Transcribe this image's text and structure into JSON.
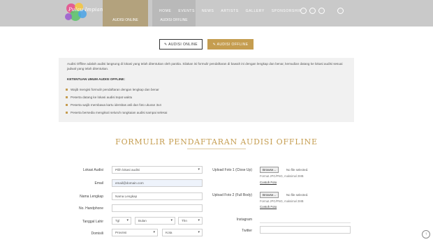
{
  "header": {
    "logo_text": "Pulau Impian",
    "tab_a": "AUDISI ONLINE",
    "tab_b": "AUDISI OFFLINE",
    "nav": [
      "HOME",
      "EVENTS",
      "NEWS",
      "ARTISTS",
      "GALLERY",
      "SPONSORSHIP"
    ],
    "social_icons": [
      "instagram-icon",
      "facebook-icon",
      "twitter-icon",
      "youtube-icon"
    ]
  },
  "buttons": {
    "online": "✎ AUDISI ONLINE",
    "offline": "✎ AUDISI OFFLINE"
  },
  "info": {
    "intro": "Audisi Offline adalah audisi langsung di lokasi yang telah ditentukan oleh panitia. Silakan isi formulir pendaftaran di bawah ini dengan lengkap dan benar, kemudian datang ke lokasi audisi sesuai jadwal yang telah ditentukan.",
    "heading": "KETENTUAN UMUM AUDISI OFFLINE:",
    "rules": [
      "Wajib mengisi formulir pendaftaran dengan lengkap dan benar",
      "Peserta datang ke lokasi audisi tepat waktu",
      "Peserta wajib membawa kartu identitas asli dan foto ukuran 3x4",
      "Peserta bersedia mengikuti seluruh rangkaian audisi sampai selesai"
    ]
  },
  "form": {
    "title": "FORMULIR PENDAFTARAN AUDISI OFFLINE",
    "labels": {
      "lokasi": "Lokasi Audisi",
      "email": "Email",
      "nama": "Nama Lengkap",
      "telp": "No. Handphone",
      "tgl": "Tanggal Lahir",
      "domisili": "Domisili",
      "foto1": "Upload Foto 1 (Close Up)",
      "foto2": "Upload Foto 2 (Full Body)",
      "instagram": "Instagram",
      "twitter": "Twitter"
    },
    "values": {
      "lokasi": "Pilih lokasi audisi",
      "email": "email@domain.com",
      "nama": "Nama Lengkap",
      "telp": "",
      "tgl_d": "Tgl",
      "tgl_m": "Bulan",
      "tgl_y": "Thn",
      "domisili_prov": "Provinsi",
      "domisili_kota": "Kota"
    },
    "file": {
      "browse": "Browse...",
      "none": "No file selected.",
      "hint1": "Format JPG/PNG, maksimal 2MB",
      "hint2": "Format JPG/PNG, maksimal 2MB",
      "link1": "Contoh Foto",
      "link2": "Contoh Foto"
    }
  },
  "scroll_top": "↑"
}
